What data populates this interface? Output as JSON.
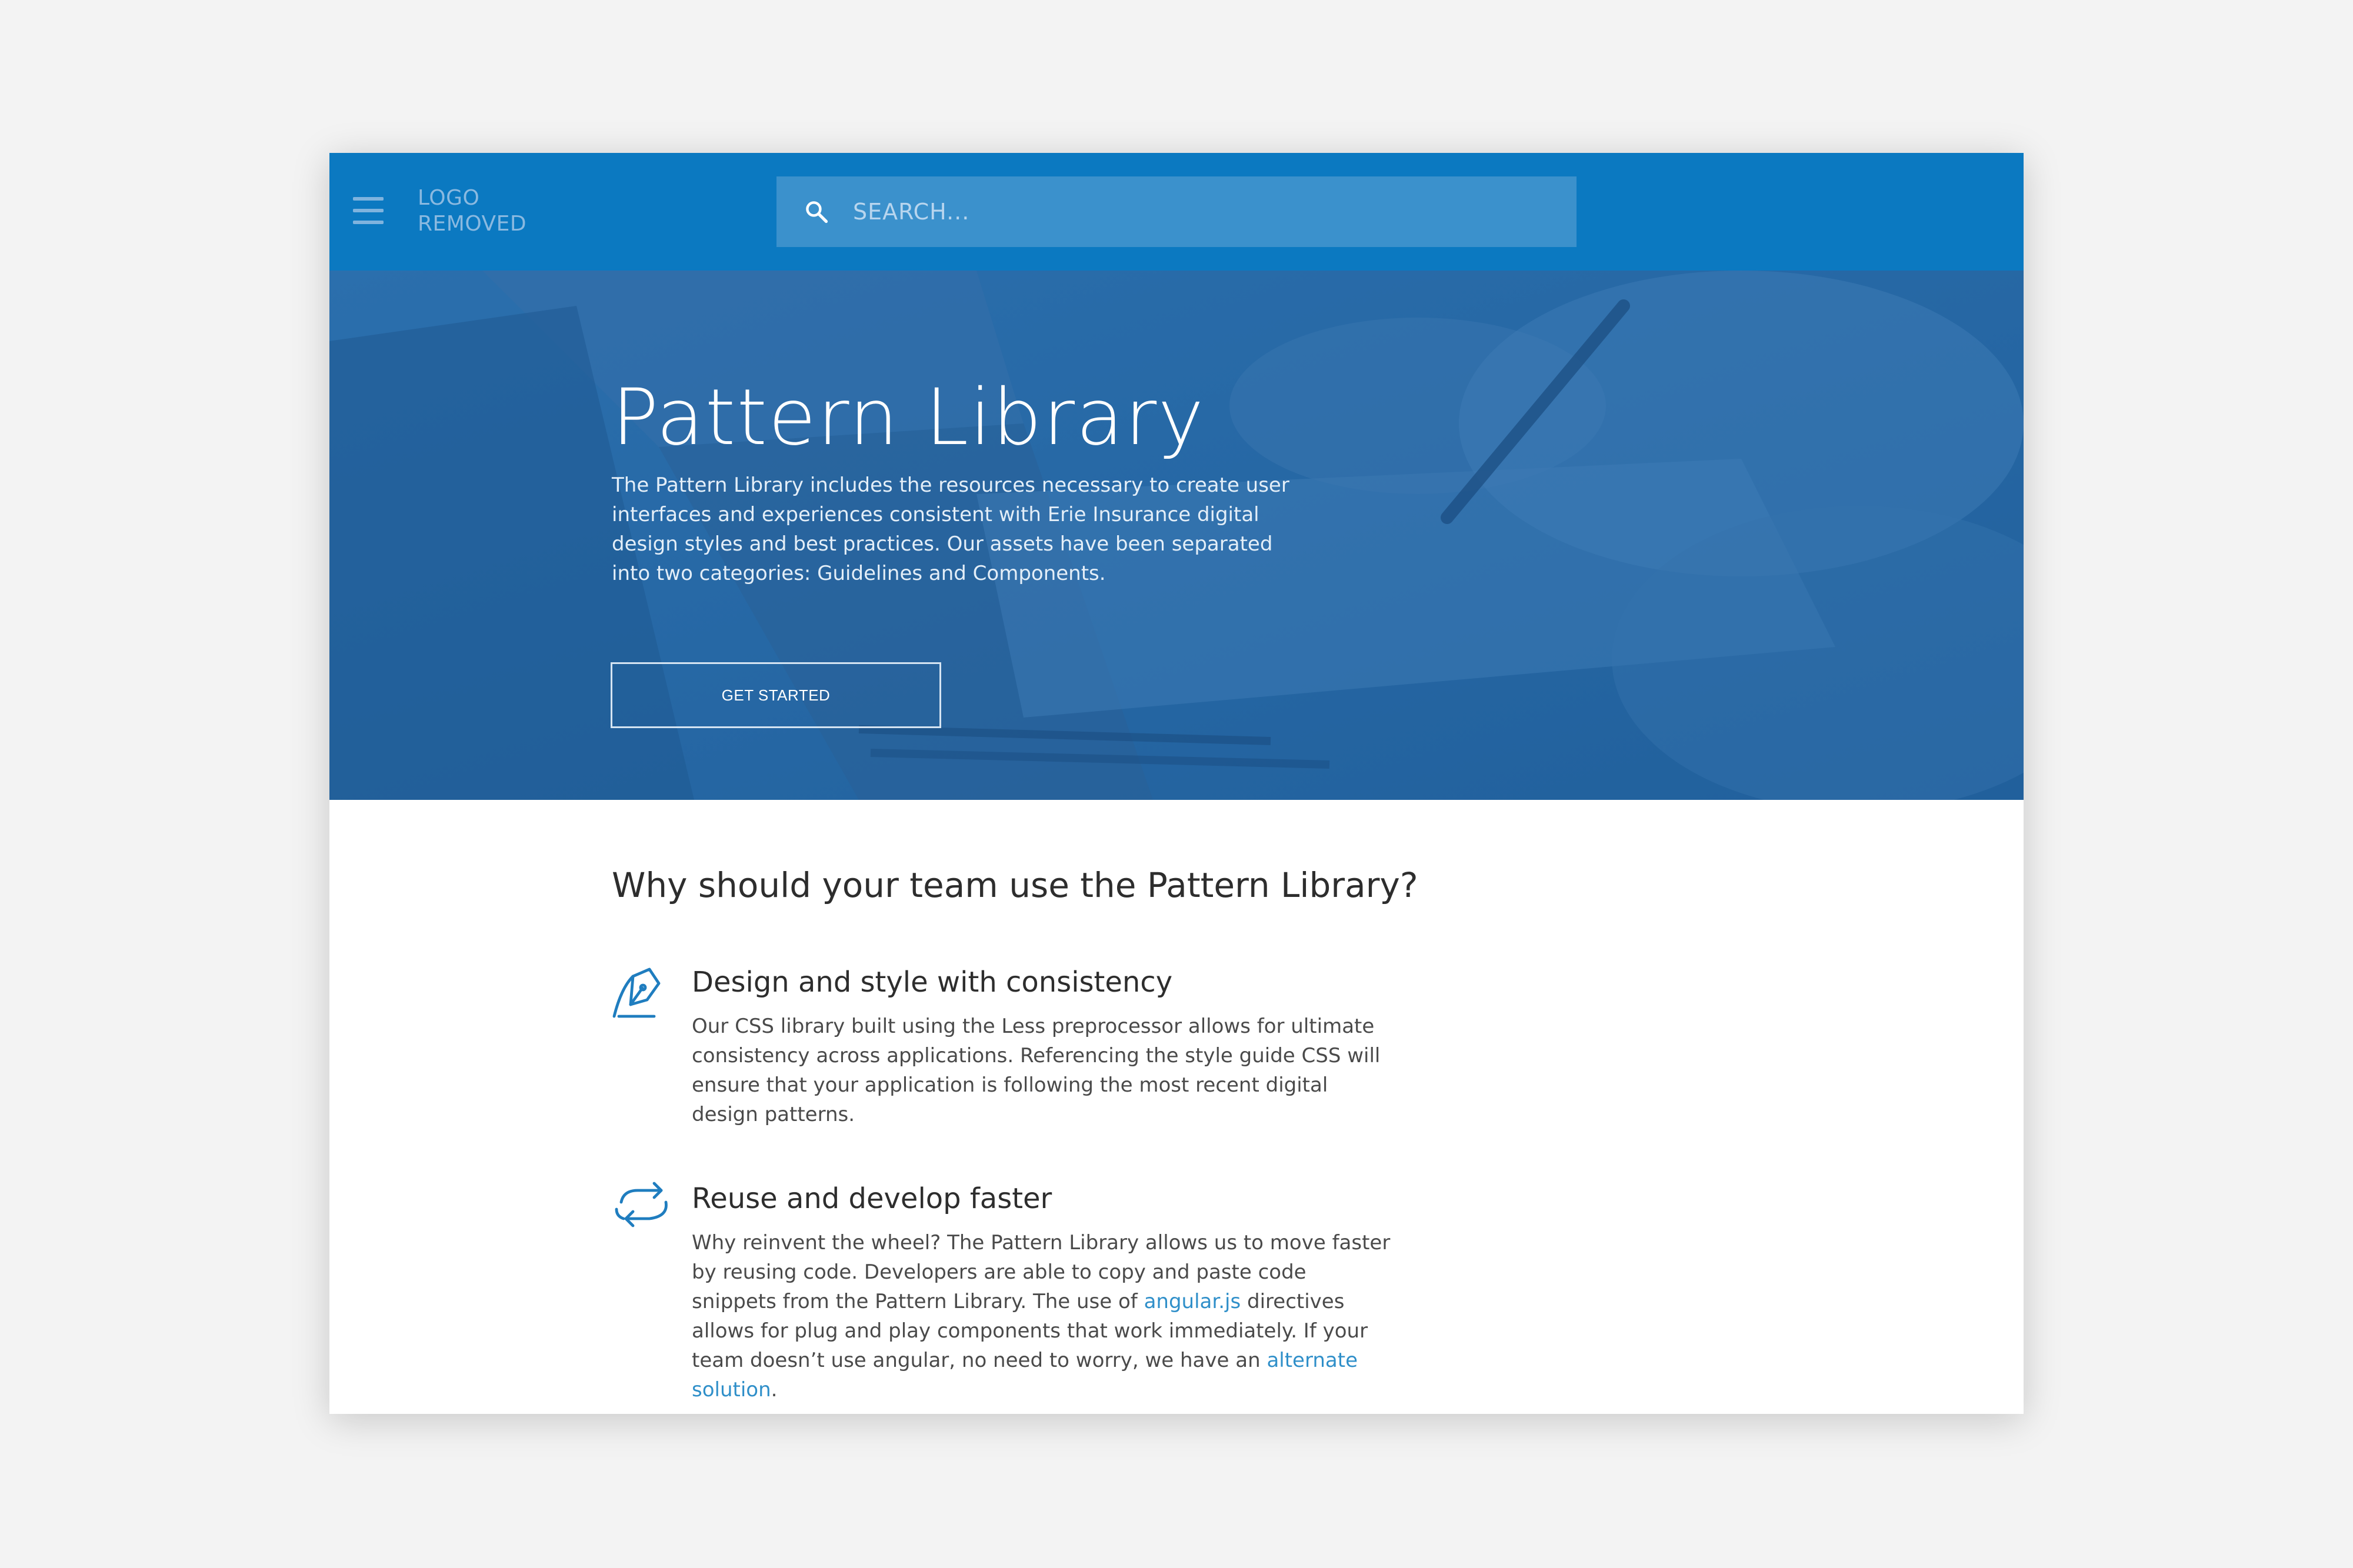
{
  "header": {
    "logo_line1": "LOGO",
    "logo_line2": "REMOVED",
    "menu_icon": "hamburger-menu-icon",
    "search": {
      "icon": "search-icon",
      "placeholder": "SEARCH..."
    }
  },
  "hero": {
    "title": "Pattern Library",
    "description": "The Pattern Library includes the resources necessary to create user interfaces and experiences consistent with Erie Insurance digital design styles and best practices. Our assets have been separated into two categories: Guidelines and Components.",
    "button_label": "GET STARTED"
  },
  "main": {
    "section_title": "Why should your team use the Pattern Library?",
    "features": [
      {
        "icon": "pen-design-icon",
        "heading": "Design and style with consistency",
        "body": "Our CSS library built using the Less preprocessor allows for ultimate consistency across applications. Referencing the style guide CSS will ensure that your application is following the most recent  digital design patterns."
      },
      {
        "icon": "reuse-cycle-icon",
        "heading": "Reuse and develop faster",
        "body_part1": "Why reinvent the wheel? The Pattern Library allows us to move faster by reusing code. Developers are able to copy and paste code snippets from the Pattern Library. The use of ",
        "link1": "angular.js",
        "body_part2": " directives allows for plug and play components that work immediately. If your team doesn’t use angular, no need to worry, we have an ",
        "link2": "alternate solution",
        "body_part3": "."
      }
    ]
  },
  "colors": {
    "header_blue": "#0b79c1",
    "hero_blue": "#2569a7",
    "link_blue": "#2f8fc9"
  }
}
